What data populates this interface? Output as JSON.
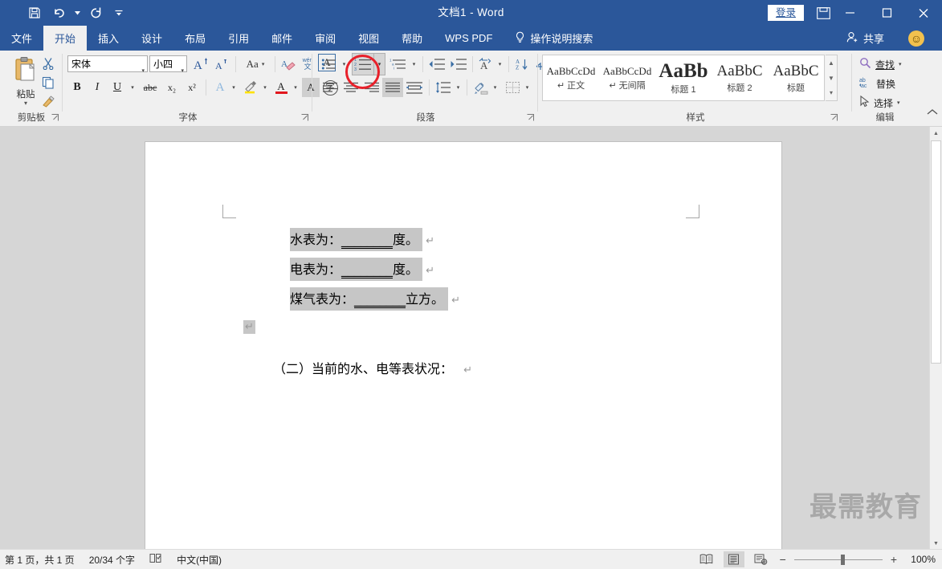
{
  "titlebar": {
    "document_title": "文档1  -  Word",
    "quick_access": [
      {
        "name": "save",
        "icon": "save-icon"
      },
      {
        "name": "undo",
        "icon": "undo-icon"
      },
      {
        "name": "redo",
        "icon": "redo-icon"
      },
      {
        "name": "customize",
        "icon": "customize-qat-icon"
      }
    ],
    "signin_label": "登录",
    "ribbon_display_options": "ribbon-display-icon",
    "minimize": "—",
    "maximize": "☐",
    "close": "✕"
  },
  "tabs": [
    {
      "label": "文件",
      "active": false
    },
    {
      "label": "开始",
      "active": true
    },
    {
      "label": "插入",
      "active": false
    },
    {
      "label": "设计",
      "active": false
    },
    {
      "label": "布局",
      "active": false
    },
    {
      "label": "引用",
      "active": false
    },
    {
      "label": "邮件",
      "active": false
    },
    {
      "label": "审阅",
      "active": false
    },
    {
      "label": "视图",
      "active": false
    },
    {
      "label": "帮助",
      "active": false
    },
    {
      "label": "WPS PDF",
      "active": false
    }
  ],
  "tellme": {
    "label": "操作说明搜索",
    "icon": "lightbulb-icon"
  },
  "share": {
    "label": "共享",
    "icon": "share-person-icon"
  },
  "account": {
    "icon": "smiley-icon",
    "glyph": "☺"
  },
  "ribbon": {
    "clipboard": {
      "group_label": "剪贴板",
      "paste_label": "粘贴",
      "buttons": [
        "cut-icon",
        "copy-icon",
        "format-painter-icon"
      ]
    },
    "font": {
      "group_label": "字体",
      "font_name": "宋体",
      "font_size": "小四",
      "grow_font": "A",
      "shrink_font": "A",
      "change_case": "Aa",
      "clear_formatting": "clear-format-icon",
      "phonetic_guide": "wén 文",
      "char_border": "A",
      "bold": "B",
      "italic": "I",
      "underline": "U",
      "strikethrough": "abc",
      "subscript": "x₂",
      "superscript": "x²",
      "text_effects": "A",
      "highlight": "highlight-icon",
      "font_color": "A",
      "char_shading": "A",
      "enclose_char": "字"
    },
    "paragraph": {
      "group_label": "段落",
      "bullets": "bullet-list-icon",
      "numbering": "numbered-list-icon",
      "multilevel": "multilevel-list-icon",
      "decrease_indent": "decrease-indent-icon",
      "increase_indent": "increase-indent-icon",
      "asian_layout": "asian-layout-icon",
      "sort": "sort-icon",
      "show_marks": "show-paragraph-marks-icon",
      "align_left": "align-left-icon",
      "align_center": "align-center-icon",
      "align_right": "align-right-icon",
      "justify": "justify-icon",
      "distribute": "distribute-icon",
      "line_spacing": "line-spacing-icon",
      "shading": "shading-icon",
      "borders": "borders-icon"
    },
    "styles": {
      "group_label": "样式",
      "items": [
        {
          "sample": "AaBbCcDd",
          "name": "正文",
          "mark": "↵",
          "size": 13,
          "bold": false
        },
        {
          "sample": "AaBbCcDd",
          "name": "无间隔",
          "mark": "↵",
          "size": 13,
          "bold": false
        },
        {
          "sample": "AaBb",
          "name": "标题 1",
          "mark": "",
          "size": 25,
          "bold": true
        },
        {
          "sample": "AaBbC",
          "name": "标题 2",
          "mark": "",
          "size": 19,
          "bold": false
        },
        {
          "sample": "AaBbC",
          "name": "标题",
          "mark": "",
          "size": 19,
          "bold": false
        }
      ]
    },
    "editing": {
      "group_label": "编辑",
      "find": "查找",
      "replace": "替换",
      "select": "选择",
      "find_icon": "magnifier-icon",
      "replace_icon": "replace-abac-icon",
      "select_icon": "cursor-arrow-icon"
    },
    "collapse_ribbon": "collapse-ribbon-icon"
  },
  "document": {
    "heading": "（二）当前的水、电等表状况：",
    "lines": [
      {
        "text": "水表为：",
        "blank": "________",
        "suffix": "度。",
        "highlighted": true
      },
      {
        "text": "电表为：",
        "blank": "________",
        "suffix": "度。",
        "highlighted": true
      },
      {
        "text": "煤气表为：",
        "blank": "________",
        "suffix": "立方。",
        "highlighted": true
      }
    ],
    "paragraph_mark": "↵",
    "watermark": "最需教育"
  },
  "status": {
    "page_info": "第 1 页，共 1 页",
    "word_count": "20/34 个字",
    "proofing_icon": "proofing-icon",
    "language": "中文(中国)",
    "views": [
      {
        "name": "read-mode",
        "icon": "read-mode-icon",
        "active": false
      },
      {
        "name": "print-layout",
        "icon": "print-layout-icon",
        "active": true
      },
      {
        "name": "web-layout",
        "icon": "web-layout-icon",
        "active": false
      }
    ],
    "zoom_out": "−",
    "zoom_in": "+",
    "zoom_level": "100%"
  },
  "annotation": {
    "target": "numbered-list-button",
    "color": "#e8202a",
    "shape": "circle"
  }
}
